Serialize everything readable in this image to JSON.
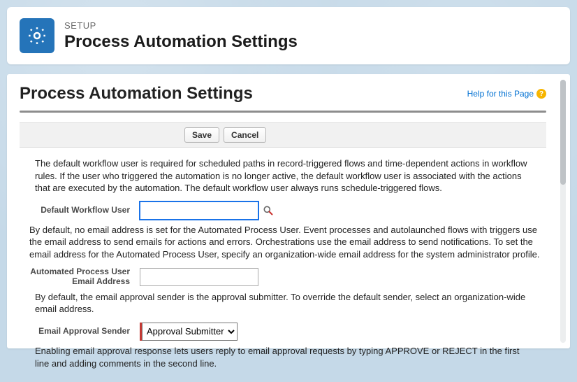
{
  "header": {
    "sup": "SETUP",
    "title": "Process Automation Settings"
  },
  "page": {
    "title": "Process Automation Settings",
    "help_link": "Help for this Page"
  },
  "buttons": {
    "save": "Save",
    "cancel": "Cancel"
  },
  "text": {
    "default_workflow_desc": "The default workflow user is required for scheduled paths in record-triggered flows and time-dependent actions in workflow rules. If the user who triggered the automation is no longer active, the default workflow user is associated with the actions that are executed by the automation. The default workflow user always runs schedule-triggered flows.",
    "automated_process_desc": "By default, no email address is set for the Automated Process User. Event processes and autolaunched flows with triggers use the email address to send emails for actions and errors. Orchestrations use the email address to send notifications. To set the email address for the Automated Process User, specify an organization-wide email address for the system administrator profile.",
    "email_approval_desc": "By default, the email approval sender is the approval submitter. To override the default sender, select an organization-wide email address.",
    "enable_email_desc": "Enabling email approval response lets users reply to email approval requests by typing APPROVE or REJECT in the first line and adding comments in the second line."
  },
  "fields": {
    "default_workflow_user": {
      "label": "Default Workflow User",
      "value": ""
    },
    "automated_process_email": {
      "label": "Automated Process User Email Address",
      "value": ""
    },
    "email_approval_sender": {
      "label": "Email Approval Sender",
      "selected": "Approval Submitter",
      "options": [
        "Approval Submitter"
      ]
    }
  }
}
